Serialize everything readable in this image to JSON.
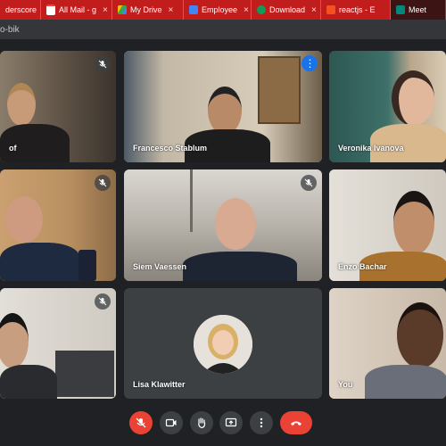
{
  "tabs": [
    {
      "label": "derscore",
      "color": "#fbbc04"
    },
    {
      "label": "All Mail - g",
      "color": "#ea4335"
    },
    {
      "label": "My Drive",
      "color": "#34a853"
    },
    {
      "label": "Employee",
      "color": "#4285f4"
    },
    {
      "label": "Download",
      "color": "#0f9d58"
    },
    {
      "label": "reactjs - E",
      "color": "#f4511e"
    },
    {
      "label": "Meet",
      "color": "#00897b"
    }
  ],
  "tab_close": "×",
  "url_text": "o-bik",
  "participants": {
    "p1": {
      "name": "of"
    },
    "p2": {
      "name": "Francesco Stablum"
    },
    "p3": {
      "name": "Veronika Ivanova"
    },
    "p5": {
      "name": "Siem Vaessen"
    },
    "p6": {
      "name": "Enzo Bachar"
    },
    "p8": {
      "name": "Lisa Klawitter"
    },
    "p9": {
      "name": "You"
    }
  },
  "more_glyph": "⋮",
  "colors": {
    "accent": "#1a73e8",
    "danger": "#ea4335",
    "tile": "#3c4043",
    "background": "#202124"
  }
}
